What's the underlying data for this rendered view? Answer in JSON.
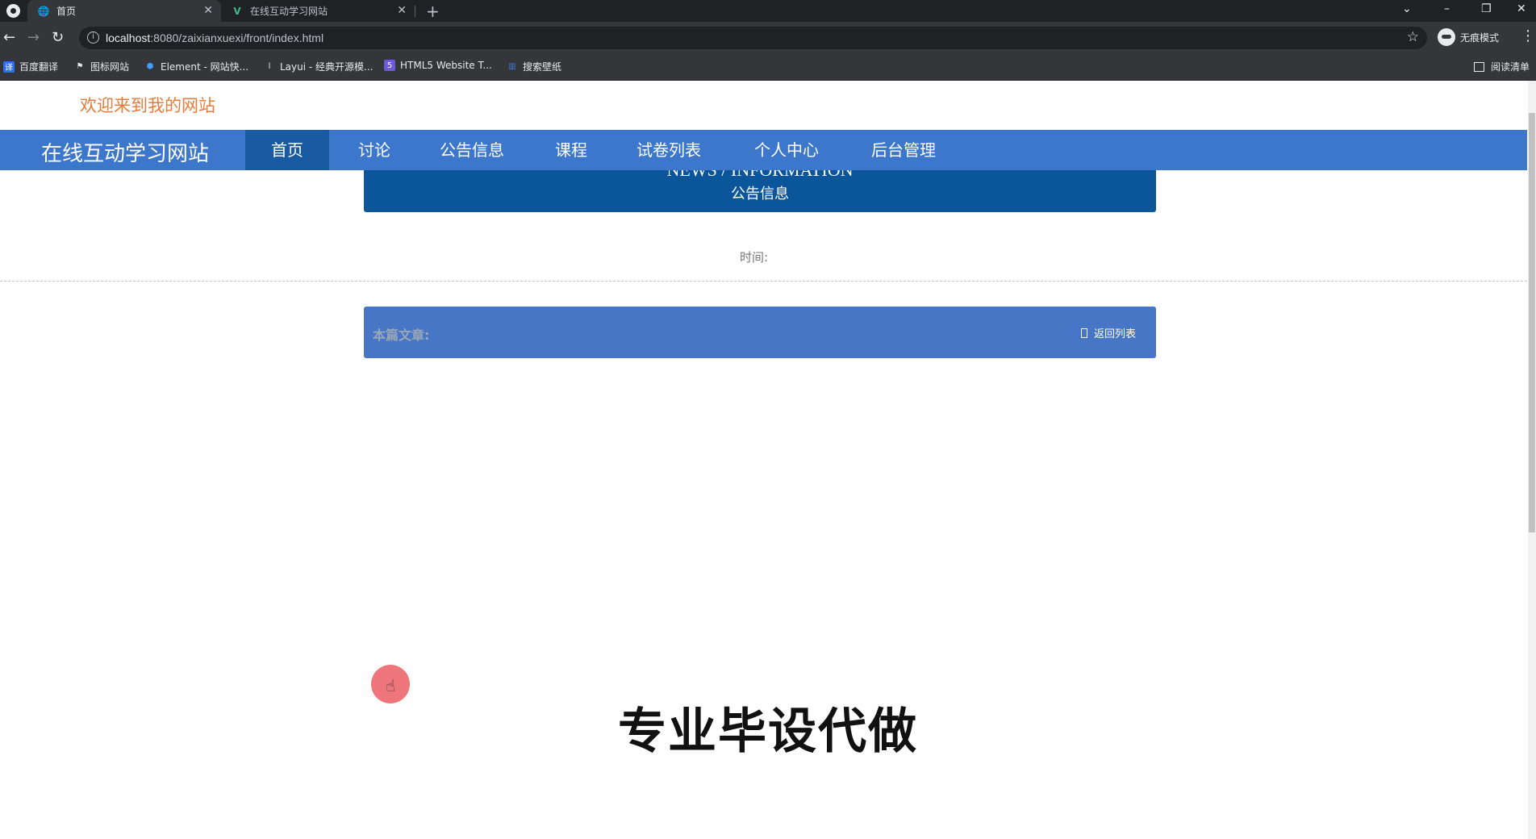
{
  "browser": {
    "tabs": [
      {
        "title": "首页",
        "active": true
      },
      {
        "title": "在线互动学习网站",
        "active": false
      }
    ],
    "url_host": "localhost",
    "url_path": ":8080/zaixianxuexi/front/index.html",
    "profile_label": "无痕模式",
    "bookmarks": [
      {
        "label": "百度翻译",
        "icon": "translate-icon",
        "color": "#2d6ef0"
      },
      {
        "label": "图标网站",
        "icon": "flag-icon",
        "color": "#111111"
      },
      {
        "label": "Element - 网站快...",
        "icon": "element-icon",
        "color": "#409eff"
      },
      {
        "label": "Layui - 经典开源模...",
        "icon": "layui-icon",
        "color": "#444444"
      },
      {
        "label": "HTML5 Website T...",
        "icon": "html5-icon",
        "color": "#6b5bd6"
      },
      {
        "label": "搜索壁纸",
        "icon": "wallpaper-icon",
        "color": "#3c7be0"
      }
    ],
    "reading_list": "阅读清单"
  },
  "site": {
    "welcome": "欢迎来到我的网站",
    "brand": "在线互动学习网站",
    "nav": [
      "首页",
      "讨论",
      "公告信息",
      "课程",
      "试卷列表",
      "个人中心",
      "后台管理"
    ],
    "active_nav": "首页",
    "colors": {
      "navbar": "#3d77cc",
      "nav_active": "#185ba3",
      "header": "#0b559a",
      "welcome": "#e47c3c"
    }
  },
  "news": {
    "header_en": "NEWS / INFORMATION",
    "header_cn": "公告信息",
    "time_label": "时间:",
    "article_label": "本篇文章:",
    "back_label": "返回列表"
  },
  "overlay": "专业毕设代做"
}
